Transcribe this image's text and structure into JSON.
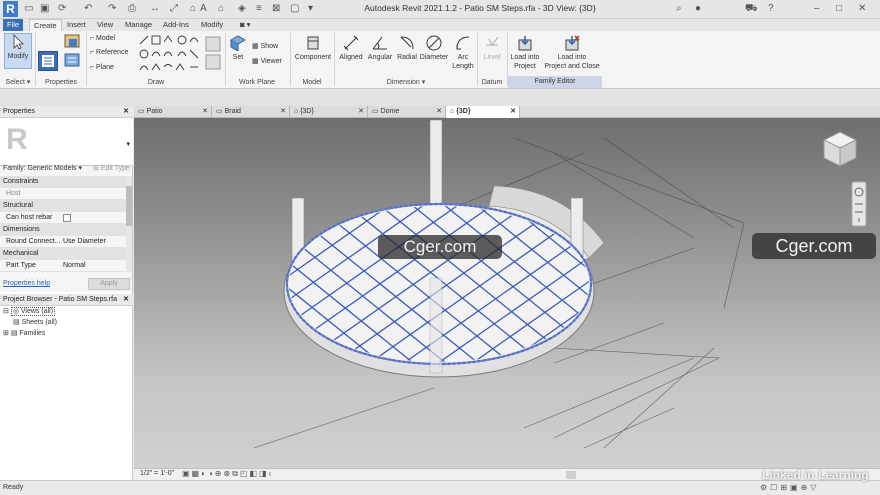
{
  "app": {
    "title": "Autodesk Revit 2021.1.2 - Patio SM Steps.rfa - 3D View: {3D}",
    "logo": "R"
  },
  "ribbon_tabs": [
    "File",
    "Create",
    "Insert",
    "View",
    "Manage",
    "Add-Ins",
    "Modify"
  ],
  "ribbon": {
    "select": {
      "modify": "Modify",
      "panel": "Select ▾"
    },
    "properties": {
      "panel": "Properties"
    },
    "draw": {
      "model": "Model",
      "reference": "Reference",
      "plane": "Plane",
      "panel": "Draw"
    },
    "work_plane": {
      "set": "Set",
      "show": "Show",
      "viewer": "Viewer",
      "panel": "Work Plane"
    },
    "model": {
      "component": "Component",
      "panel": "Model"
    },
    "dimension": {
      "aligned": "Aligned",
      "angular": "Angular",
      "radial": "Radial",
      "diameter": "Diameter",
      "arc_length_1": "Arc",
      "arc_length_2": "Length",
      "panel": "Dimension ▾"
    },
    "datum": {
      "level": "Level",
      "panel": "Datum"
    },
    "family_editor": {
      "load_into_project_1": "Load into",
      "load_into_project_2": "Project",
      "load_close_1": "Load into",
      "load_close_2": "Project and Close",
      "panel": "Family Editor"
    }
  },
  "properties": {
    "title": "Properties",
    "type_icon": "R",
    "family": "Family: Generic Models",
    "edit_type": "Edit Type",
    "categories": [
      "Constraints",
      "Structural",
      "Dimensions",
      "Mechanical"
    ],
    "rows": {
      "host": {
        "key": "Host",
        "value": ""
      },
      "can_host_rebar": {
        "key": "Can host rebar",
        "value": ""
      },
      "round_connect": {
        "key": "Round Connect...",
        "value": "Use Diameter"
      },
      "part_type": {
        "key": "Part Type",
        "value": "Normal"
      }
    },
    "help": "Properties help",
    "apply": "Apply"
  },
  "project_browser": {
    "title": "Project Browser - Patio SM Steps.rfa",
    "items": [
      "Views (all)",
      "Sheets (all)",
      "Families"
    ]
  },
  "view_tabs": [
    "Patio",
    "Braid",
    "{3D}",
    "Dome",
    "{3D}"
  ],
  "viewbar": {
    "scale": "1/2\" = 1'-0\""
  },
  "status": {
    "text": "Ready"
  },
  "watermarks": {
    "center": "Cger.com",
    "right": "Cger.com",
    "linkedin": "Linked in Learning"
  },
  "colors": {
    "grid_blue": "#3a5bb8",
    "accent": "#3a6fb5",
    "family_editor": "#cfd5e6"
  }
}
